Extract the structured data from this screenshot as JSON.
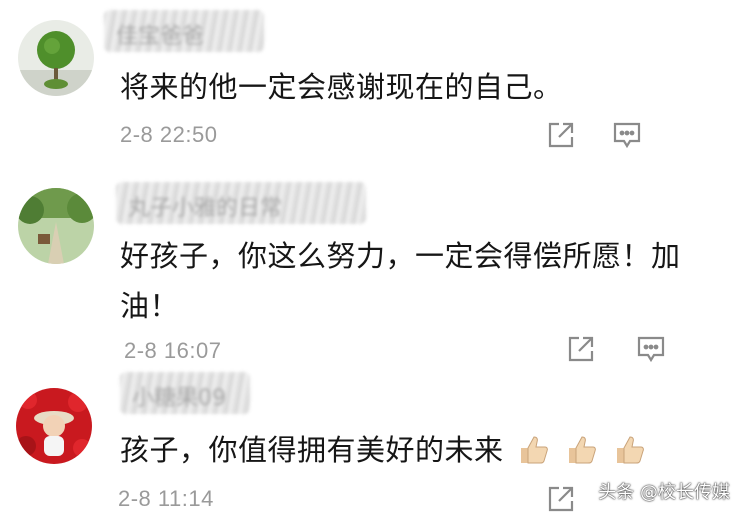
{
  "comments": [
    {
      "username": "佳宝爸爸",
      "text": "将来的他一定会感谢现在的自己。",
      "time": "2-8 22:50"
    },
    {
      "username": "丸子小雅的日常",
      "text_line1": "好孩子，你这么努力，一定会得偿所愿！加",
      "text_line2": "油！",
      "time": "2-8 16:07"
    },
    {
      "username": "小糖果09",
      "text": "孩子，你值得拥有美好的未来",
      "time": "2-8 11:14"
    }
  ],
  "icons": {
    "share": "share-icon",
    "reply": "comment-icon",
    "thumbs_up": "thumbs-up-emoji"
  },
  "watermark": "头条 @校长传媒",
  "colors": {
    "text": "#161616",
    "time": "#9a9a9a",
    "icon": "#8a8a8a"
  }
}
